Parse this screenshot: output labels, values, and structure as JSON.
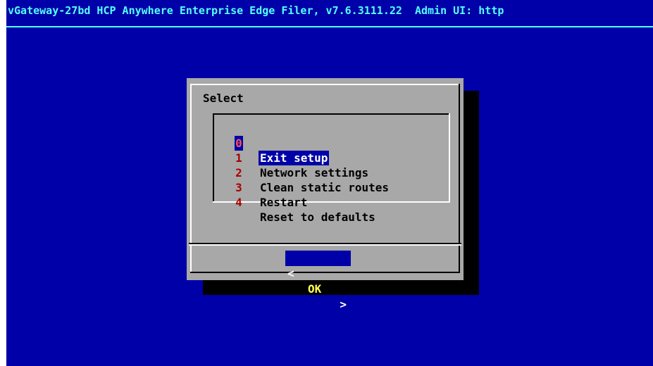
{
  "window": {
    "title": "vGateway-27bd HCP Anywhere Enterprise Edge Filer, v7.6.3111.22  Admin UI: http"
  },
  "dialog": {
    "title": "Select",
    "items": [
      {
        "tag": "0",
        "label": "Exit setup",
        "selected": true
      },
      {
        "tag": "1",
        "label": "Network settings",
        "selected": false
      },
      {
        "tag": "2",
        "label": "Clean static routes",
        "selected": false
      },
      {
        "tag": "3",
        "label": "Restart",
        "selected": false
      },
      {
        "tag": "4",
        "label": "Reset to defaults",
        "selected": false
      }
    ],
    "ok_button": {
      "left": "<",
      "label": "OK",
      "right": ">"
    }
  },
  "colors": {
    "background": "#0000a8",
    "title_text": "#55ffff",
    "dialog_bg": "#a8a8a8",
    "tag_text": "#a80000",
    "selection_bg": "#0000a8",
    "button_label": "#ffff55"
  }
}
